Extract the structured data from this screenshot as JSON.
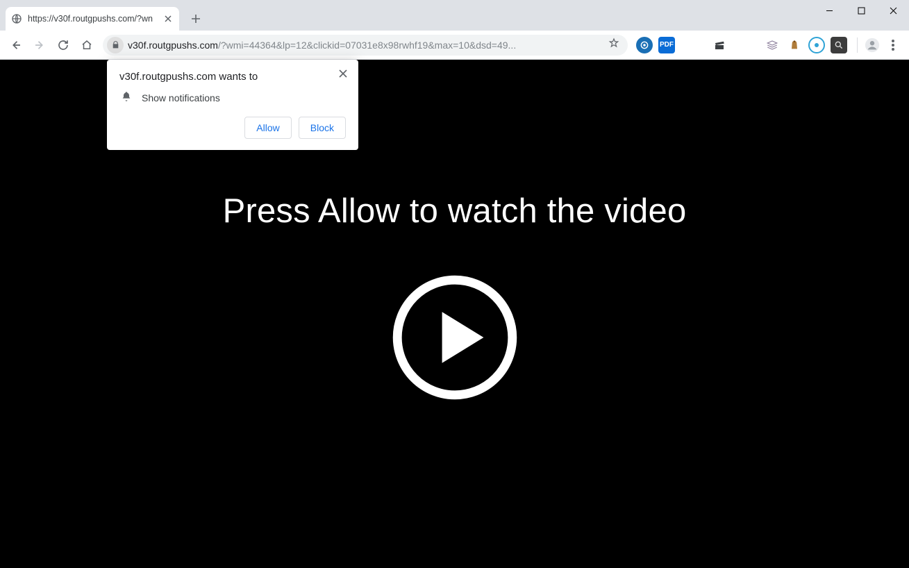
{
  "tab": {
    "title": "https://v30f.routgpushs.com/?wn"
  },
  "omnibox": {
    "host": "v30f.routgpushs.com",
    "rest": "/?wmi=44364&lp=12&clickid=07031e8x98rwhf19&max=10&dsd=49..."
  },
  "extensions": {
    "pdf_label": "PDF"
  },
  "permission": {
    "title": "v30f.routgpushs.com wants to",
    "item": "Show notifications",
    "allow": "Allow",
    "block": "Block"
  },
  "page": {
    "headline": "Press Allow to watch the video"
  }
}
